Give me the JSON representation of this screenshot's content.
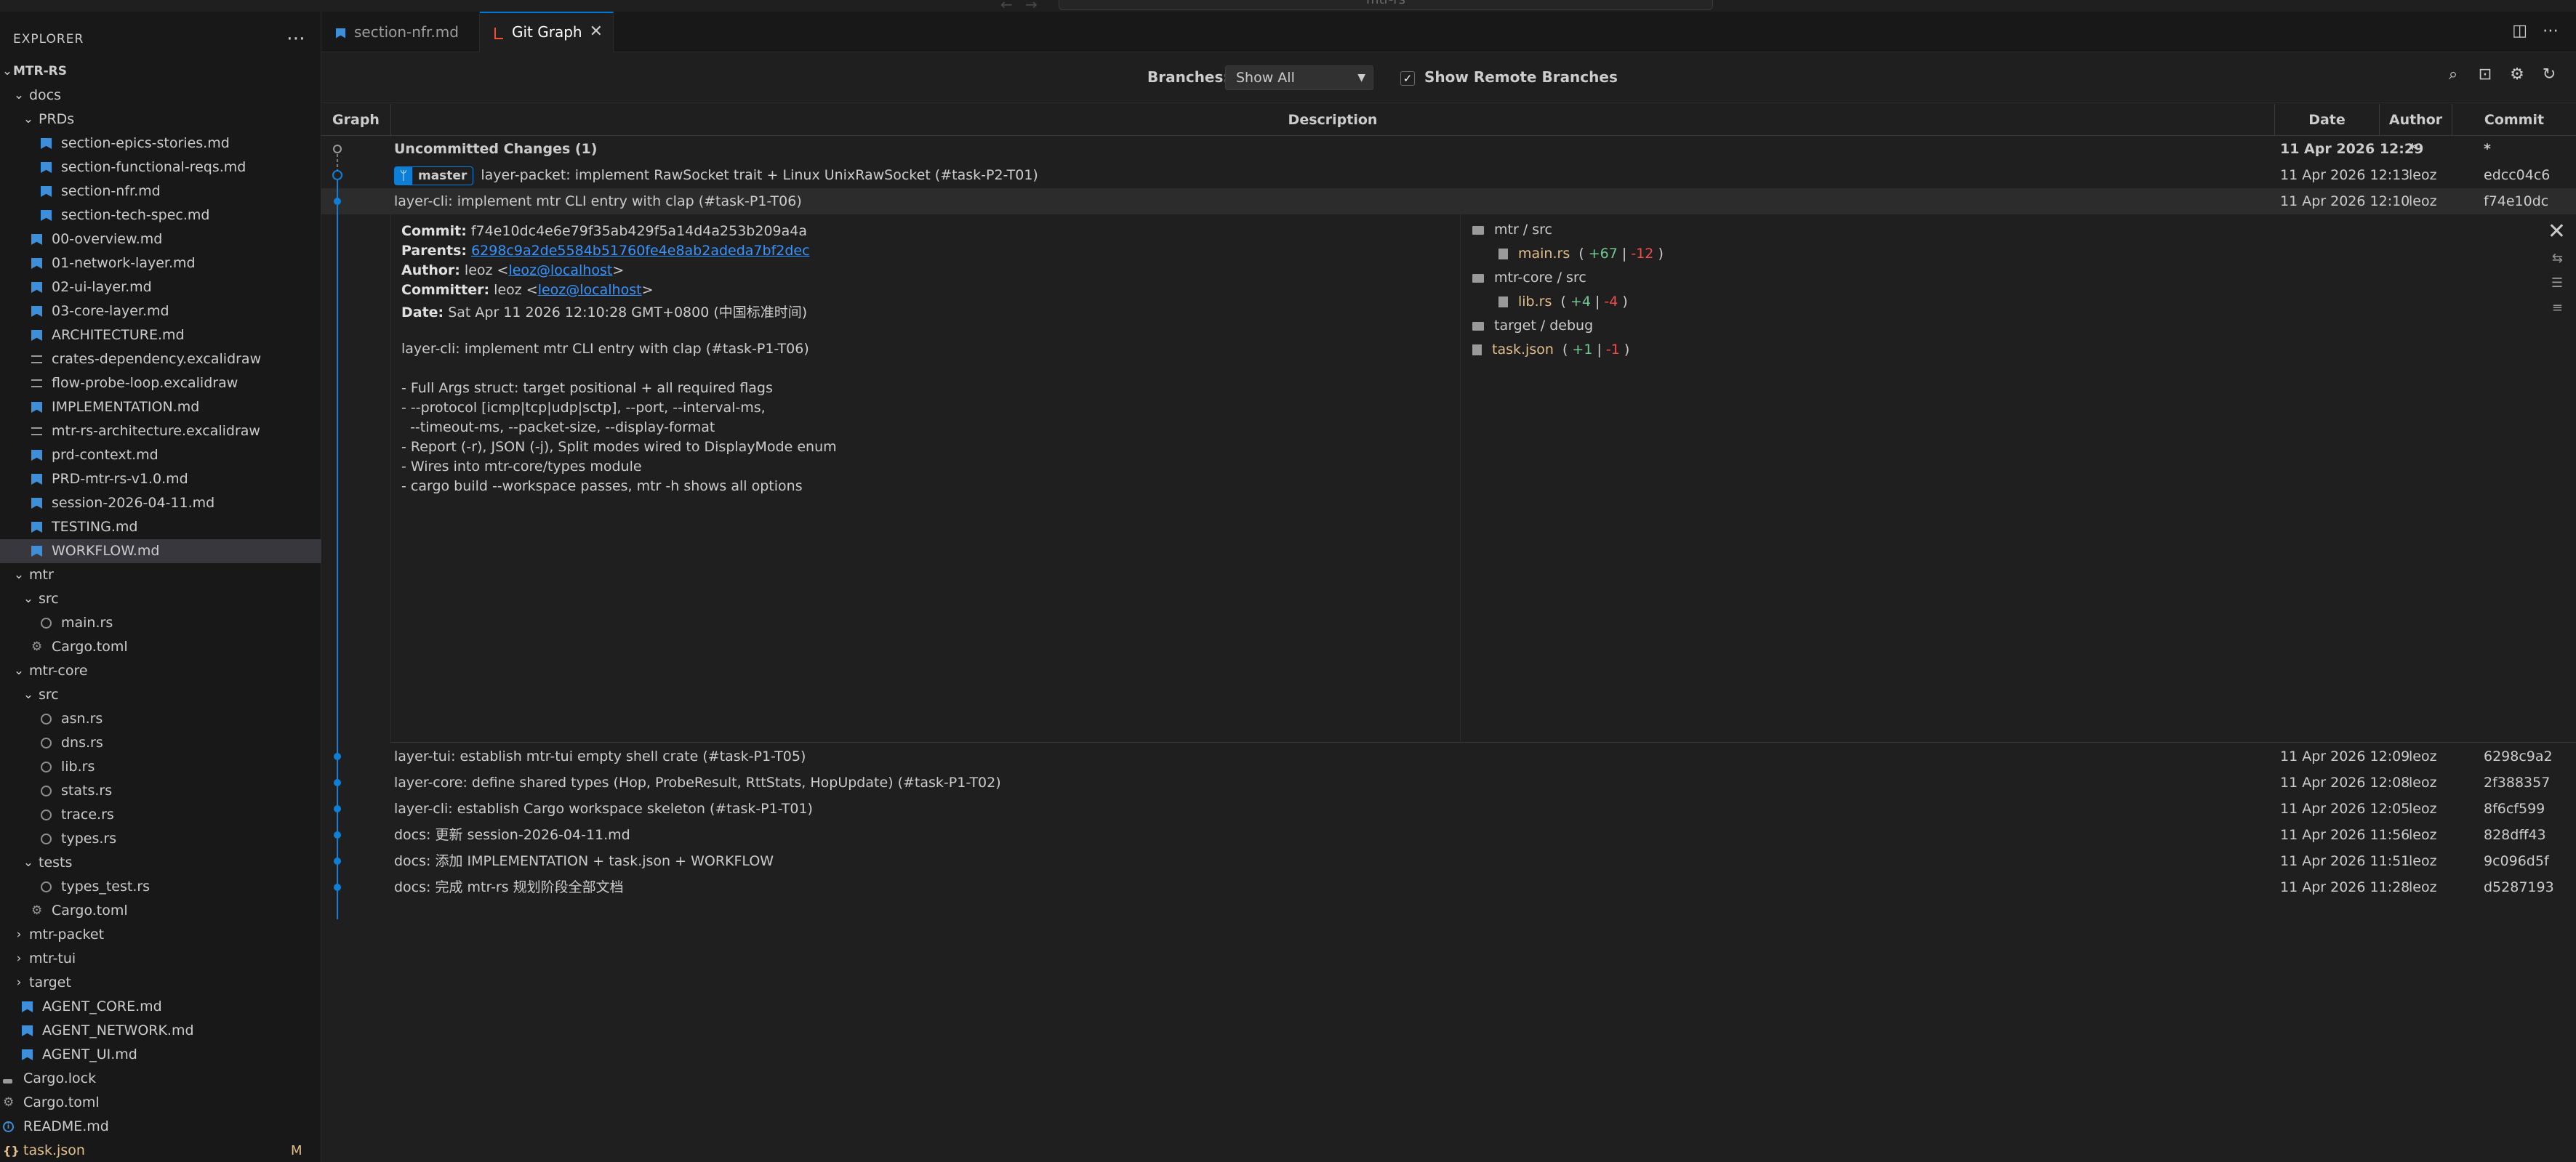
{
  "titlebar": {
    "command_center": "mtr-rs",
    "nav_back": "←",
    "nav_forward": "→"
  },
  "explorer": {
    "title": "EXPLORER",
    "more": "⋯",
    "root": "MTR-RS",
    "items": [
      {
        "label": "docs",
        "type": "folder",
        "depth": 0
      },
      {
        "label": "PRDs",
        "type": "folder",
        "depth": 1
      },
      {
        "label": "section-epics-stories.md",
        "type": "md",
        "depth": 2
      },
      {
        "label": "section-functional-reqs.md",
        "type": "md",
        "depth": 2
      },
      {
        "label": "section-nfr.md",
        "type": "md",
        "depth": 2
      },
      {
        "label": "section-tech-spec.md",
        "type": "md",
        "depth": 2
      },
      {
        "label": "00-overview.md",
        "type": "md",
        "depth": 1
      },
      {
        "label": "01-network-layer.md",
        "type": "md",
        "depth": 1
      },
      {
        "label": "02-ui-layer.md",
        "type": "md",
        "depth": 1
      },
      {
        "label": "03-core-layer.md",
        "type": "md",
        "depth": 1
      },
      {
        "label": "ARCHITECTURE.md",
        "type": "md",
        "depth": 1
      },
      {
        "label": "crates-dependency.excalidraw",
        "type": "ex",
        "depth": 1
      },
      {
        "label": "flow-probe-loop.excalidraw",
        "type": "ex",
        "depth": 1
      },
      {
        "label": "IMPLEMENTATION.md",
        "type": "md",
        "depth": 1
      },
      {
        "label": "mtr-rs-architecture.excalidraw",
        "type": "ex",
        "depth": 1
      },
      {
        "label": "prd-context.md",
        "type": "md",
        "depth": 1
      },
      {
        "label": "PRD-mtr-rs-v1.0.md",
        "type": "md",
        "depth": 1
      },
      {
        "label": "session-2026-04-11.md",
        "type": "md",
        "depth": 1
      },
      {
        "label": "TESTING.md",
        "type": "md",
        "depth": 1
      },
      {
        "label": "WORKFLOW.md",
        "type": "md",
        "depth": 1,
        "selected": true
      },
      {
        "label": "mtr",
        "type": "folder",
        "depth": 0
      },
      {
        "label": "src",
        "type": "folder",
        "depth": 1
      },
      {
        "label": "main.rs",
        "type": "rs",
        "depth": 2
      },
      {
        "label": "Cargo.toml",
        "type": "gear",
        "depth": 1
      },
      {
        "label": "mtr-core",
        "type": "folder",
        "depth": 0
      },
      {
        "label": "src",
        "type": "folder",
        "depth": 1
      },
      {
        "label": "asn.rs",
        "type": "rs",
        "depth": 2
      },
      {
        "label": "dns.rs",
        "type": "rs",
        "depth": 2
      },
      {
        "label": "lib.rs",
        "type": "rs",
        "depth": 2
      },
      {
        "label": "stats.rs",
        "type": "rs",
        "depth": 2
      },
      {
        "label": "trace.rs",
        "type": "rs",
        "depth": 2
      },
      {
        "label": "types.rs",
        "type": "rs",
        "depth": 2
      },
      {
        "label": "tests",
        "type": "folder",
        "depth": 1
      },
      {
        "label": "types_test.rs",
        "type": "rs",
        "depth": 2
      },
      {
        "label": "Cargo.toml",
        "type": "gear",
        "depth": 1
      },
      {
        "label": "mtr-packet",
        "type": "folder-closed",
        "depth": 0
      },
      {
        "label": "mtr-tui",
        "type": "folder-closed",
        "depth": 0
      },
      {
        "label": "target",
        "type": "folder-closed",
        "depth": 0
      },
      {
        "label": "AGENT_CORE.md",
        "type": "md",
        "depth": 0
      },
      {
        "label": "AGENT_NETWORK.md",
        "type": "md",
        "depth": 0
      },
      {
        "label": "AGENT_UI.md",
        "type": "md",
        "depth": 0
      },
      {
        "label": "Cargo.lock",
        "type": "lock",
        "depth": -1
      },
      {
        "label": "Cargo.toml",
        "type": "gear",
        "depth": -1
      },
      {
        "label": "README.md",
        "type": "info",
        "depth": -1
      },
      {
        "label": "task.json",
        "type": "json",
        "depth": -1,
        "modified": "M"
      }
    ]
  },
  "tabs": [
    {
      "label": "section-nfr.md",
      "active": false
    },
    {
      "label": "Git Graph",
      "active": true,
      "close": "✕"
    }
  ],
  "gitgraph": {
    "branches_label": "Branches:",
    "branches_value": "Show All",
    "show_remote_label": "Show Remote Branches",
    "show_remote_checked": true,
    "columns": {
      "graph": "Graph",
      "description": "Description",
      "date": "Date",
      "author": "Author",
      "commit": "Commit"
    },
    "uncommitted": {
      "description": "Uncommitted Changes (1)",
      "date": "11 Apr 2026 12:29",
      "author": "*",
      "commit": "*"
    },
    "head_row": {
      "branch": "master",
      "description": "layer-packet: implement RawSocket trait + Linux UnixRawSocket (#task-P2-T01)",
      "date": "11 Apr 2026 12:13",
      "author": "leoz",
      "commit": "edcc04c6"
    },
    "selected_row": {
      "description": "layer-cli: implement mtr CLI entry with clap (#task-P1-T06)",
      "date": "11 Apr 2026 12:10",
      "author": "leoz",
      "commit": "f74e10dc"
    },
    "details": {
      "commit_label": "Commit:",
      "commit": "f74e10dc4e6e79f35ab429f5a14d4a253b209a4a",
      "parents_label": "Parents:",
      "parents": "6298c9a2de5584b51760fe4e8ab2adeda7bf2dec",
      "author_label": "Author:",
      "author_name": "leoz <",
      "author_email": "leoz@localhost",
      "author_end": ">",
      "committer_label": "Committer:",
      "committer_name": "leoz <",
      "committer_email": "leoz@localhost",
      "committer_end": ">",
      "date_label": "Date:",
      "date": "Sat Apr 11 2026 12:10:28 GMT+0800 (中国标准时间)",
      "message": [
        "layer-cli: implement mtr CLI entry with clap (#task-P1-T06)",
        "",
        "- Full Args struct: target positional + all required flags",
        "- --protocol [icmp|tcp|udp|sctp], --port, --interval-ms,",
        "  --timeout-ms, --packet-size, --display-format",
        "- Report (-r), JSON (-j), Split modes wired to DisplayMode enum",
        "- Wires into mtr-core/types module",
        "- cargo build --workspace passes, mtr -h shows all options"
      ],
      "files": [
        {
          "folder": "mtr / src"
        },
        {
          "file": "main.rs",
          "add": "+67",
          "del": "-12"
        },
        {
          "folder": "mtr-core / src"
        },
        {
          "file": "lib.rs",
          "add": "+4",
          "del": "-4"
        },
        {
          "folder": "target / debug"
        },
        {
          "root_file": "task.json",
          "add": "+1",
          "del": "-1"
        }
      ]
    },
    "commits": [
      {
        "description": "layer-tui: establish mtr-tui empty shell crate (#task-P1-T05)",
        "date": "11 Apr 2026 12:09",
        "author": "leoz",
        "commit": "6298c9a2"
      },
      {
        "description": "layer-core: define shared types (Hop, ProbeResult, RttStats, HopUpdate) (#task-P1-T02)",
        "date": "11 Apr 2026 12:08",
        "author": "leoz",
        "commit": "2f388357"
      },
      {
        "description": "layer-cli: establish Cargo workspace skeleton (#task-P1-T01)",
        "date": "11 Apr 2026 12:05",
        "author": "leoz",
        "commit": "8f6cf599"
      },
      {
        "description": "docs: 更新 session-2026-04-11.md",
        "date": "11 Apr 2026 11:56",
        "author": "leoz",
        "commit": "828dff43"
      },
      {
        "description": "docs: 添加 IMPLEMENTATION + task.json + WORKFLOW",
        "date": "11 Apr 2026 11:51",
        "author": "leoz",
        "commit": "9c096d5f"
      },
      {
        "description": "docs: 完成 mtr-rs 规划阶段全部文档",
        "date": "11 Apr 2026 11:28",
        "author": "leoz",
        "commit": "d5287193"
      }
    ]
  },
  "colors": {
    "accent": "#0078d4",
    "graph": "#0e7fd6",
    "added": "#73c991",
    "deleted": "#f14c4c",
    "modified": "#e2c08d",
    "link": "#3794ff"
  }
}
